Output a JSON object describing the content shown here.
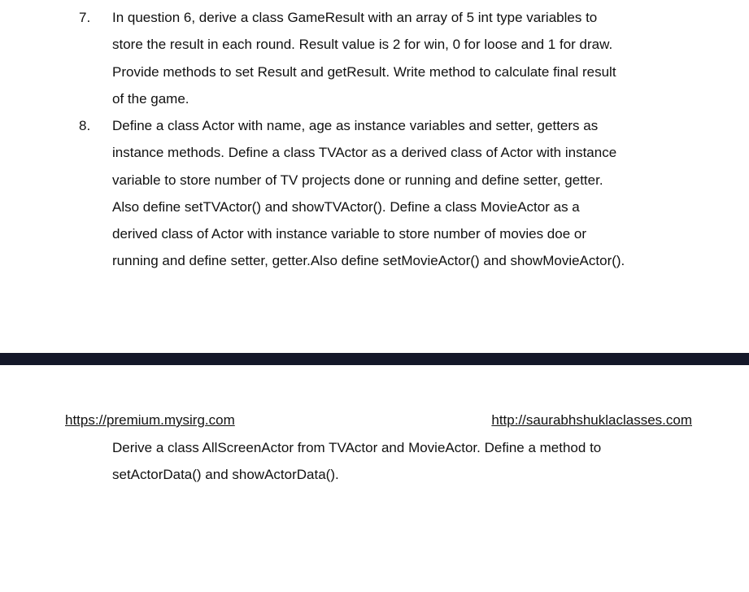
{
  "questions": [
    {
      "number": "7.",
      "lines": [
        "In question 6, derive a class GameResult with an array of 5 int type variables to",
        "store the result in each round. Result value is 2 for win, 0 for loose and 1 for draw.",
        "Provide methods to set Result and getResult. Write method to calculate final result",
        "of the game."
      ]
    },
    {
      "number": "8.",
      "lines": [
        "Define  a class Actor with name, age as instance variables and setter, getters as",
        "instance methods. Define a class TVActor as a derived class of Actor with instance",
        "variable to store number of TV projects done or running and define setter, getter.",
        "Also define setTVActor() and showTVActor().  Define a class MovieActor as a",
        "derived class of Actor with instance variable to store number of movies doe or",
        "running and define setter, getter.Also define setMovieActor() and showMovieActor()."
      ]
    }
  ],
  "header_links": {
    "left": "https://premium.mysirg.com",
    "right": "http://saurabhshuklaclasses.com"
  },
  "continuation": {
    "lines": [
      "Derive a class AllScreenActor from TVActor and MovieActor. Define a method to",
      "setActorData() and showActorData()."
    ]
  }
}
